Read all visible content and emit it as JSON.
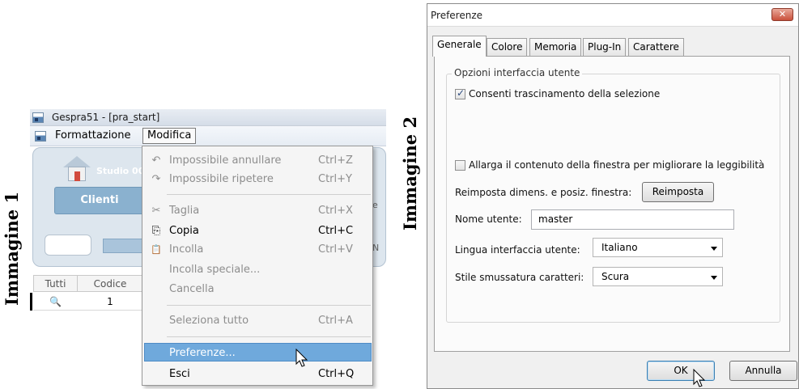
{
  "captions": {
    "left": "Immagine 1",
    "right": "Immagine 2"
  },
  "app": {
    "title": "Gespra51 - [pra_start]",
    "menu": [
      "Formattazione",
      "Modifica"
    ]
  },
  "bg": {
    "studio": "Studio 00",
    "clienti": "Clienti",
    "grid_headers": [
      "Tutti",
      "Codice"
    ],
    "row_value": "1"
  },
  "edit_menu": [
    {
      "label": "Impossibile annullare",
      "shortcut": "Ctrl+Z",
      "icon": "↶",
      "disabled": true
    },
    {
      "label": "Impossibile ripetere",
      "shortcut": "Ctrl+Y",
      "icon": "↷",
      "disabled": true
    },
    {
      "label": "Taglia",
      "shortcut": "Ctrl+X",
      "icon": "✂",
      "disabled": true
    },
    {
      "label": "Copia",
      "shortcut": "Ctrl+C",
      "icon": "⎘",
      "disabled": false
    },
    {
      "label": "Incolla",
      "shortcut": "Ctrl+V",
      "icon": "📋",
      "disabled": true
    },
    {
      "label": "Incolla speciale...",
      "shortcut": "",
      "icon": "",
      "disabled": true
    },
    {
      "label": "Cancella",
      "shortcut": "",
      "icon": "",
      "disabled": true
    },
    {
      "label": "Seleziona tutto",
      "shortcut": "Ctrl+A",
      "icon": "",
      "disabled": true
    },
    {
      "label": "Preferenze...",
      "shortcut": "",
      "icon": "",
      "disabled": false,
      "highlighted": true
    },
    {
      "label": "Esci",
      "shortcut": "Ctrl+Q",
      "icon": "",
      "disabled": false
    }
  ],
  "dialog": {
    "title": "Preferenze",
    "close": "✕",
    "tabs": [
      "Generale",
      "Colore",
      "Memoria",
      "Plug-In",
      "Carattere"
    ],
    "active_tab": "Generale",
    "group_label": "Opzioni interfaccia utente",
    "chk_drag": {
      "label": "Consenti trascinamento della selezione",
      "checked": true
    },
    "chk_enlarge": {
      "label": "Allarga il contenuto della finestra per migliorare la leggibilità",
      "checked": false
    },
    "reset_label": "Reimposta dimens. e posiz. finestra:",
    "reset_button": "Reimposta",
    "user_label": "Nome utente:",
    "user_value": "master",
    "lang_label": "Lingua interfaccia utente:",
    "lang_value": "Italiano",
    "font_label": "Stile smussatura caratteri:",
    "font_value": "Scura",
    "ok": "OK",
    "cancel": "Annulla"
  },
  "colors": {
    "highlight": "#6fa9dc",
    "close_button": "#c9503b"
  }
}
